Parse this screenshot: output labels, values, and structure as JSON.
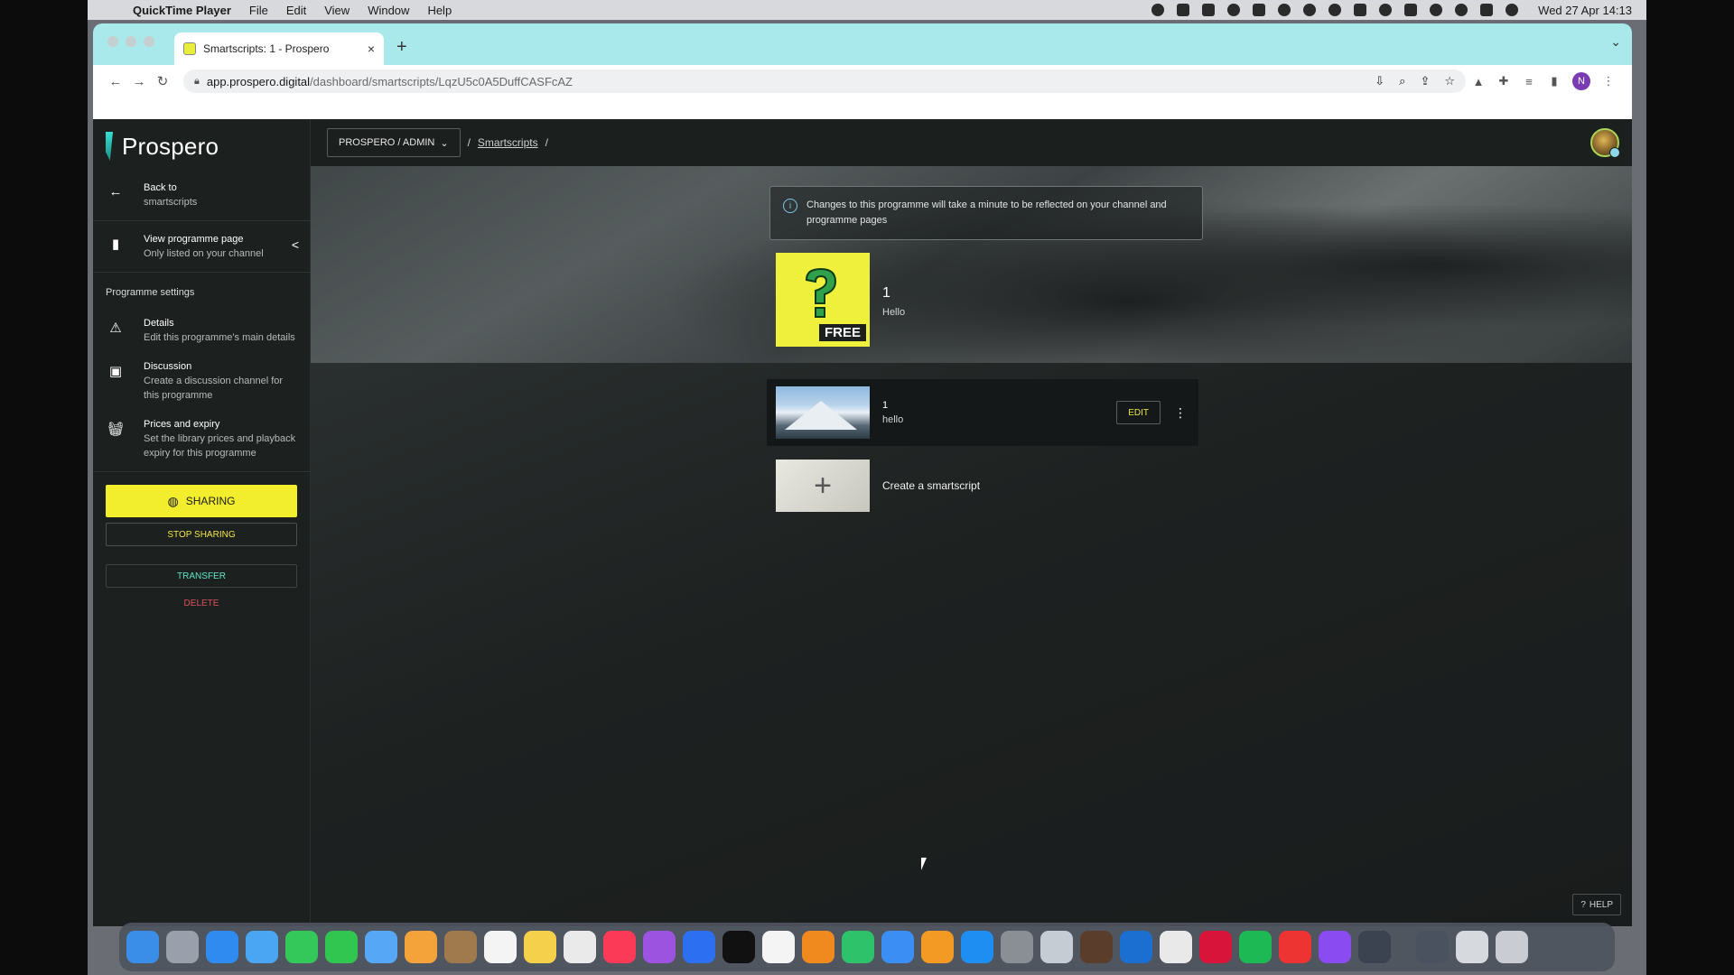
{
  "menubar": {
    "app_name": "QuickTime Player",
    "items": [
      "File",
      "Edit",
      "View",
      "Window",
      "Help"
    ],
    "clock": "Wed 27 Apr  14:13"
  },
  "browser": {
    "tab_title": "Smartscripts: 1 - Prospero",
    "url_domain": "app.prospero.digital",
    "url_path": "/dashboard/smartscripts/LqzU5c0A5DuffCASFcAZ",
    "profile_initial": "N"
  },
  "sidebar": {
    "logo": "Prospero",
    "back": {
      "title": "Back to",
      "subtitle": "smartscripts"
    },
    "view_page": {
      "title": "View programme page",
      "subtitle": "Only listed on your channel"
    },
    "section_label": "Programme settings",
    "settings": [
      {
        "title": "Details",
        "subtitle": "Edit this programme's main details"
      },
      {
        "title": "Discussion",
        "subtitle": "Create a discussion channel for this programme"
      },
      {
        "title": "Prices and expiry",
        "subtitle": "Set the library prices and playback expiry for this programme"
      }
    ],
    "sharing_label": "SHARING",
    "stop_sharing_label": "STOP SHARING",
    "transfer_label": "TRANSFER",
    "delete_label": "DELETE"
  },
  "topbar": {
    "breadcrumb_select": "PROSPERO / ADMIN",
    "breadcrumb_link": "Smartscripts"
  },
  "notice": {
    "message": "Changes to this programme will take a minute to be reflected on your channel and programme pages"
  },
  "programme": {
    "number": "1",
    "subtitle": "Hello",
    "badge": "FREE"
  },
  "smartscripts": [
    {
      "number": "1",
      "subtitle": "hello",
      "edit_label": "EDIT"
    }
  ],
  "create_label": "Create a smartscript",
  "help_label": "HELP",
  "colors": {
    "accent_yellow": "#f2ee2e",
    "transfer_teal": "#5fe6c6",
    "delete_red": "#e0505e",
    "tabbar": "#a9e8eb"
  }
}
